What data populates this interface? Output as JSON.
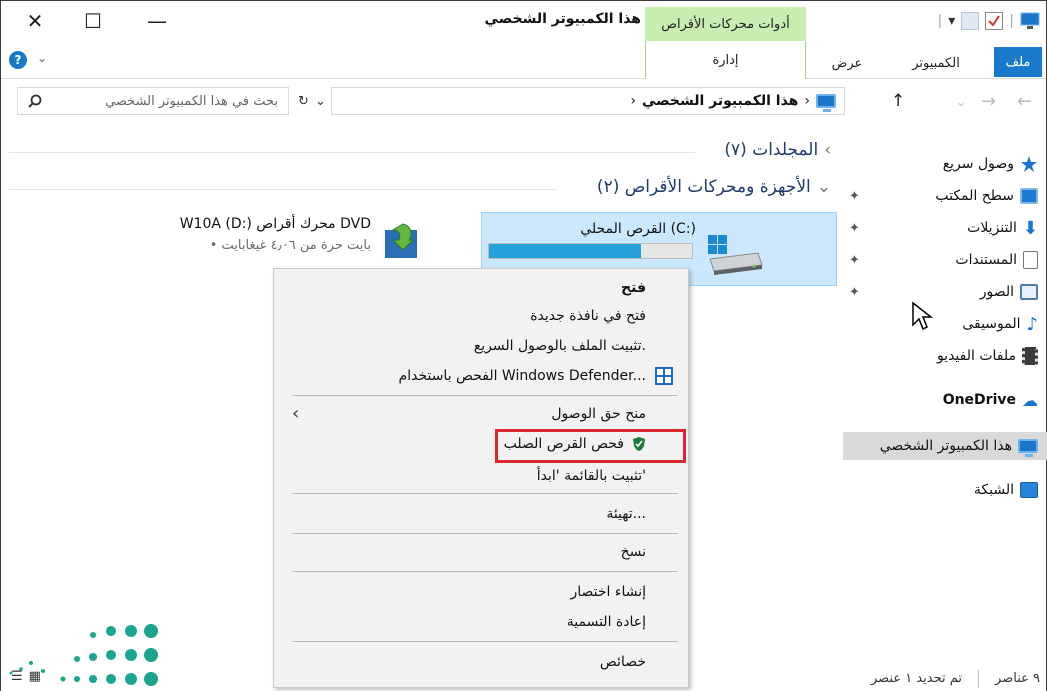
{
  "window": {
    "title": "هذا الكمبيوتر الشخصي",
    "close": "✕",
    "maximize": "☐",
    "minimize": "—"
  },
  "ribbon": {
    "contextual_tab": "أدوات محركات الأقراص",
    "contextual_sub": "إدارة",
    "tabs": {
      "file": "ملف",
      "computer": "الكمبيوتر",
      "view": "عرض"
    },
    "help": "?"
  },
  "address": {
    "crumb": "هذا الكمبيوتر الشخصي",
    "sep": "›",
    "search_placeholder": "بحث في هذا الكمبيوتر الشخصي"
  },
  "sections": {
    "folders": "المجلدات (٧)",
    "devices": "الأجهزة ومحركات الأقراص (٢)"
  },
  "drives": {
    "c": {
      "label": "القرص المحلي (C:)",
      "used_fraction": 0.75
    },
    "d": {
      "name": "W10A (D:) محرك أقراص DVD",
      "sub": "• بايت حرة من ٤٫٠٦ غيغابايت"
    }
  },
  "navpane": {
    "items": [
      {
        "label": "وصول سريع",
        "icon": "star-icon"
      },
      {
        "label": "سطح المكتب",
        "icon": "desktop-folder-icon"
      },
      {
        "label": "التنزيلات",
        "icon": "download-arrow-icon"
      },
      {
        "label": "المستندات",
        "icon": "document-icon"
      },
      {
        "label": "الصور",
        "icon": "pictures-icon"
      },
      {
        "label": "الموسيقى",
        "icon": "music-note-icon"
      },
      {
        "label": "ملفات الفيديو",
        "icon": "film-icon"
      },
      {
        "label": "OneDrive",
        "icon": "cloud-icon"
      },
      {
        "label": "هذا الكمبيوتر الشخصي",
        "icon": "computer-icon"
      },
      {
        "label": "الشبكة",
        "icon": "network-icon"
      }
    ]
  },
  "menu": {
    "open": "فتح",
    "open_new_window": "فتح في نافذة جديدة",
    "pin_quick": "تثبيت الملف بالوصول السريع.",
    "defender": "الفحص باستخدام Windows Defender...",
    "give_access": "منح حق الوصول",
    "check_disk": "فحص القرص الصلب",
    "pin_start": "تثبيت بالقائمة 'ابدأ'",
    "format": "تهيئة...",
    "copy": "نسخ",
    "create_shortcut": "إنشاء اختصار",
    "rename": "إعادة التسمية",
    "properties": "خصائص"
  },
  "status": {
    "items_count": "٩ عناصر",
    "selected": "تم تحديد ١ عنصر"
  },
  "colors": {
    "accent": "#1979ca",
    "contextual": "#c9ecb0",
    "highlight_box": "#d8282d",
    "selection": "#cce8ff"
  }
}
